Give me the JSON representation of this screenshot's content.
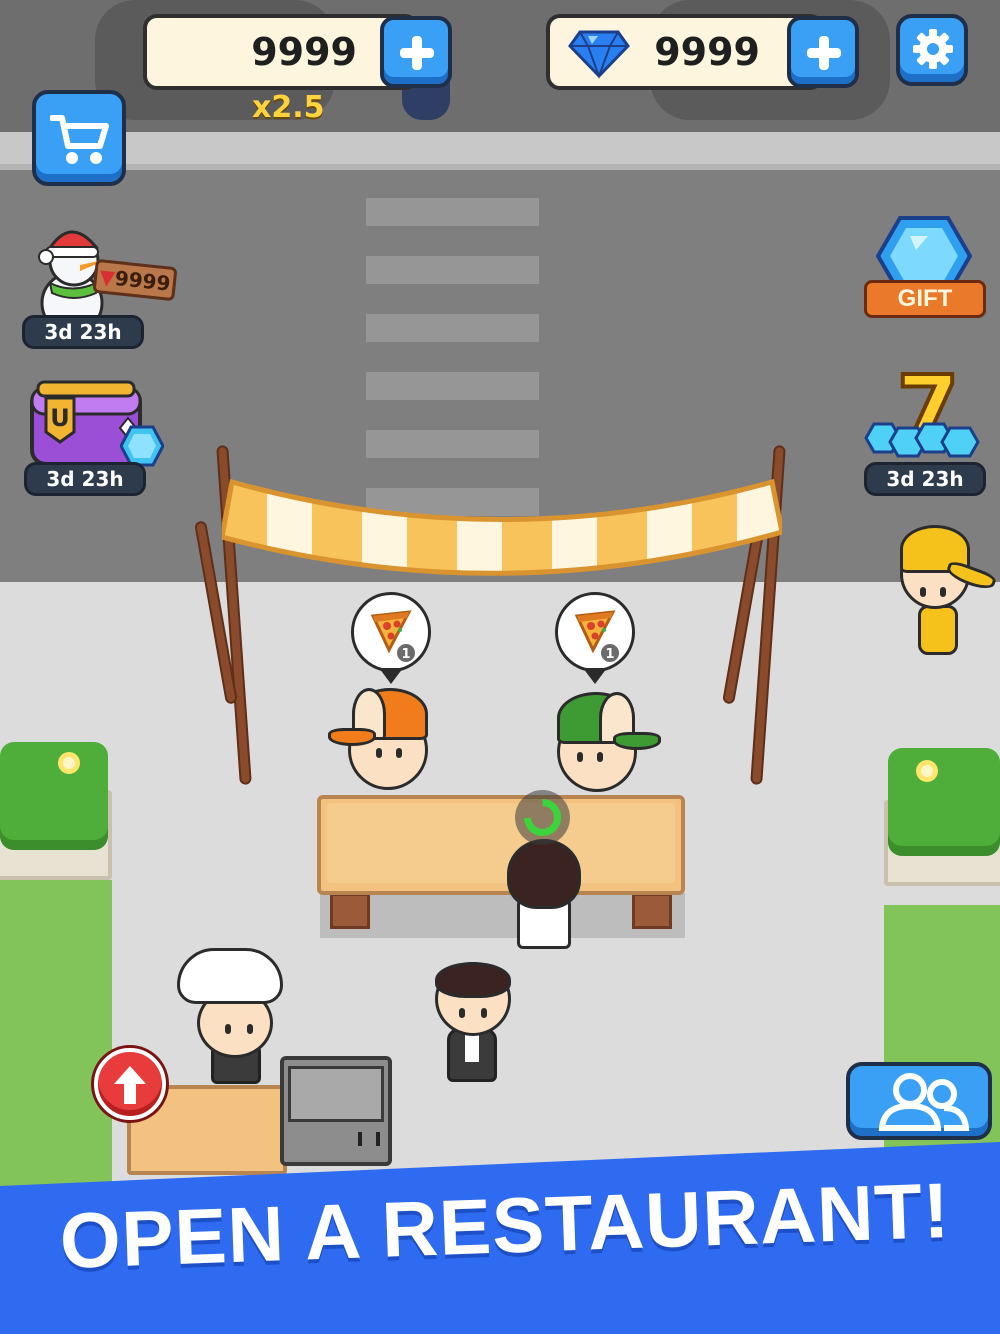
{
  "hud": {
    "coins": {
      "value": "9999",
      "icon": "coin-icon"
    },
    "gems": {
      "value": "9999",
      "icon": "gem-icon"
    },
    "multiplier": "x2.5",
    "settings_icon": "gear-icon"
  },
  "side_left": [
    {
      "name": "snowman-event",
      "timer": "3d 23h",
      "sign": "9999",
      "icon": "snowman-icon"
    },
    {
      "name": "chest-offer",
      "timer": "3d 23h",
      "icon": "chest-icon",
      "chest_letter": "U"
    }
  ],
  "side_right": [
    {
      "name": "gift",
      "label": "GIFT",
      "icon": "gift-gem-icon"
    },
    {
      "name": "lucky-seven",
      "timer": "3d 23h",
      "label": "7",
      "icon": "slot-seven-icon"
    }
  ],
  "orders": [
    {
      "item": "pizza-icon",
      "count": "1"
    },
    {
      "item": "pizza-icon",
      "count": "1"
    }
  ],
  "banner": {
    "text": "OPEN A RESTAURANT!"
  },
  "colors": {
    "button_blue": "#3aa0f5",
    "banner_blue": "#2f6bf0",
    "gold": "#ffd23f",
    "awning_yellow": "#f7c35a"
  }
}
